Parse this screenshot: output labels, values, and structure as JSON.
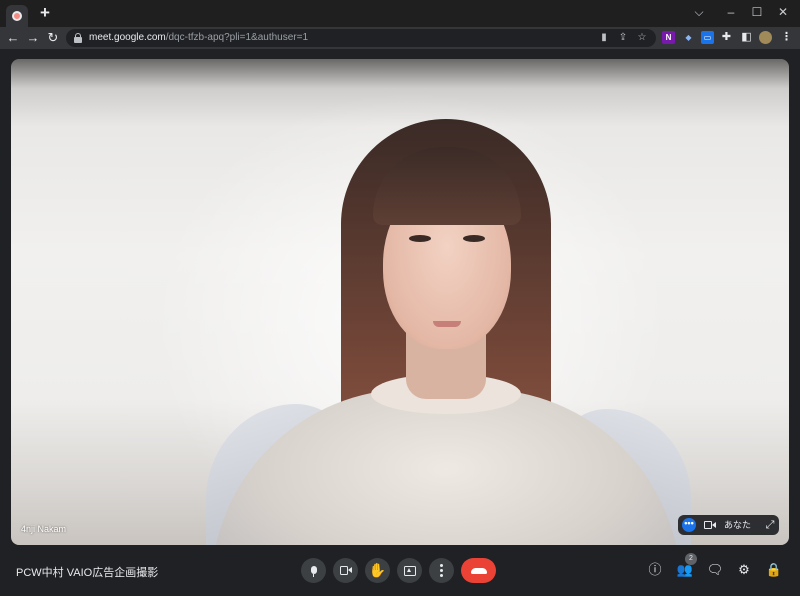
{
  "browser": {
    "newtab_glyph": "+",
    "window_controls": {
      "minimize": "–",
      "maximize": "☐",
      "close": "✕",
      "tabsearch": "⌵"
    },
    "url_host": "meet.google.com",
    "url_path": "/dqc-tfzb-apq?pli=1&authuser=1"
  },
  "video": {
    "participant_name": "4nji Nakam",
    "self_label": "あなた",
    "self_more": "•••"
  },
  "bottom": {
    "meeting_title": "PCW中村 VAIO広告企画撮影",
    "people_count": "2"
  },
  "colors": {
    "hangup": "#ea4335",
    "accent": "#1a73e8",
    "bg": "#202124"
  }
}
